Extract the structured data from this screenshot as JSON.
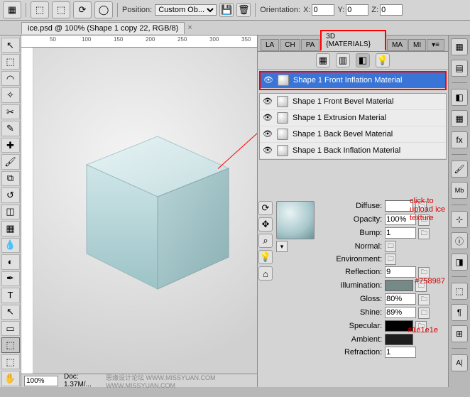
{
  "topbar": {
    "position_label": "Position:",
    "position_value": "Custom Ob...",
    "orientation_label": "Orientation:",
    "x_label": "X:",
    "x_val": "0",
    "y_label": "Y:",
    "y_val": "0",
    "z_label": "Z:",
    "z_val": "0"
  },
  "document_tab": "ice.psd @ 100% (Shape 1 copy 22, RGB/8)",
  "ruler_marks": [
    "50",
    "100",
    "150",
    "200",
    "250",
    "300",
    "350"
  ],
  "panel_tabs": [
    "LA",
    "CH",
    "PA",
    "3D {MATERIALS}",
    "MA",
    "MI"
  ],
  "materials": [
    "Shape 1 Front Inflation Material",
    "Shape 1 Front Bevel Material",
    "Shape 1 Extrusion Material",
    "Shape 1 Back Bevel Material",
    "Shape 1 Back Inflation Material"
  ],
  "props": {
    "diffuse": "Diffuse:",
    "opacity_label": "Opacity:",
    "opacity": "100%",
    "bump_label": "Bump:",
    "bump": "1",
    "normal": "Normal:",
    "environment": "Environment:",
    "reflection_label": "Reflection:",
    "reflection": "9",
    "illumination": "Illumination:",
    "gloss_label": "Gloss:",
    "gloss": "80%",
    "shine_label": "Shine:",
    "shine": "89%",
    "specular": "Specular:",
    "ambient": "Ambient:",
    "refraction_label": "Refraction:",
    "refraction": "1"
  },
  "colors": {
    "diffuse": "#ffffff",
    "illumination": "#758987",
    "specular": "#000000",
    "ambient": "#1e1e1e"
  },
  "annotations": {
    "click_upload": "click to upload ice texture",
    "illum_hex": "#758987",
    "ambient_hex": "#1e1e1e"
  },
  "status": {
    "zoom": "100%",
    "doc_label": "Doc:",
    "doc": "1.37M/...",
    "watermark": "思缘设计论坛  WWW.MISSYUAN.COM  WWW.MISSYUAN.COM"
  },
  "tools": [
    "↖",
    "▭",
    "⬚",
    "⌕",
    "✂",
    "✎",
    "⌫",
    "✐",
    "⧉",
    "↺",
    "T",
    "▭",
    "⬭",
    "☰",
    "◧",
    "⬚"
  ],
  "float_icons": [
    "▦",
    "▤",
    "◧",
    "◨",
    "🗀",
    "✎",
    "Mb",
    "¶",
    "▤",
    "fx",
    "⟐",
    "⬚",
    "¶",
    "⊞",
    "A|"
  ]
}
